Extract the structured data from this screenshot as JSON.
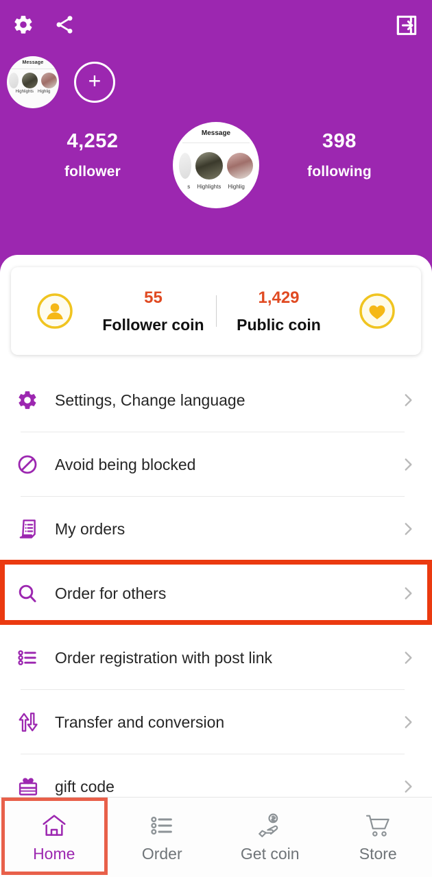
{
  "theme": {
    "brand_purple": "#9C27B0",
    "highlight_red": "#EB3A10",
    "nav_highlight_red": "#E8604A",
    "coin_number_color": "#E04A22",
    "coin_badge_gold": "#F5BE18"
  },
  "header": {
    "settings_icon": "gear-icon",
    "share_icon": "share-icon",
    "logout_icon": "logout-icon",
    "add_story_label": "+",
    "story_avatar": {
      "title": "Message",
      "labels": [
        "Highlights",
        "Highlig"
      ]
    },
    "profile_pic": {
      "title": "Message",
      "labels": [
        "Highlights",
        "Highlig",
        "s"
      ]
    },
    "stats": [
      {
        "value": "4,252",
        "label": "follower"
      },
      {
        "value": "398",
        "label": "following"
      }
    ]
  },
  "coin_card": {
    "left_icon": "person-coin-icon",
    "right_icon": "heart-coin-icon",
    "items": [
      {
        "value": "55",
        "label": "Follower coin"
      },
      {
        "value": "1,429",
        "label": "Public coin"
      }
    ]
  },
  "menu": {
    "items": [
      {
        "icon": "gear-icon",
        "label": "Settings, Change language"
      },
      {
        "icon": "block-icon",
        "label": "Avoid being blocked"
      },
      {
        "icon": "invoice-icon",
        "label": "My orders"
      },
      {
        "icon": "search-icon",
        "label": "Order for others",
        "highlighted": true
      },
      {
        "icon": "list-icon",
        "label": "Order registration with post link"
      },
      {
        "icon": "transfer-icon",
        "label": "Transfer and conversion"
      },
      {
        "icon": "gift-icon",
        "label": "gift code"
      }
    ],
    "chevron_icon": "chevron-right-icon"
  },
  "bottom_nav": {
    "items": [
      {
        "icon": "home-icon",
        "label": "Home",
        "active": true,
        "highlighted": true
      },
      {
        "icon": "list-icon",
        "label": "Order",
        "active": false,
        "highlighted": false
      },
      {
        "icon": "get-coin-icon",
        "label": "Get coin",
        "active": false,
        "highlighted": false
      },
      {
        "icon": "cart-icon",
        "label": "Store",
        "active": false,
        "highlighted": false
      }
    ]
  }
}
